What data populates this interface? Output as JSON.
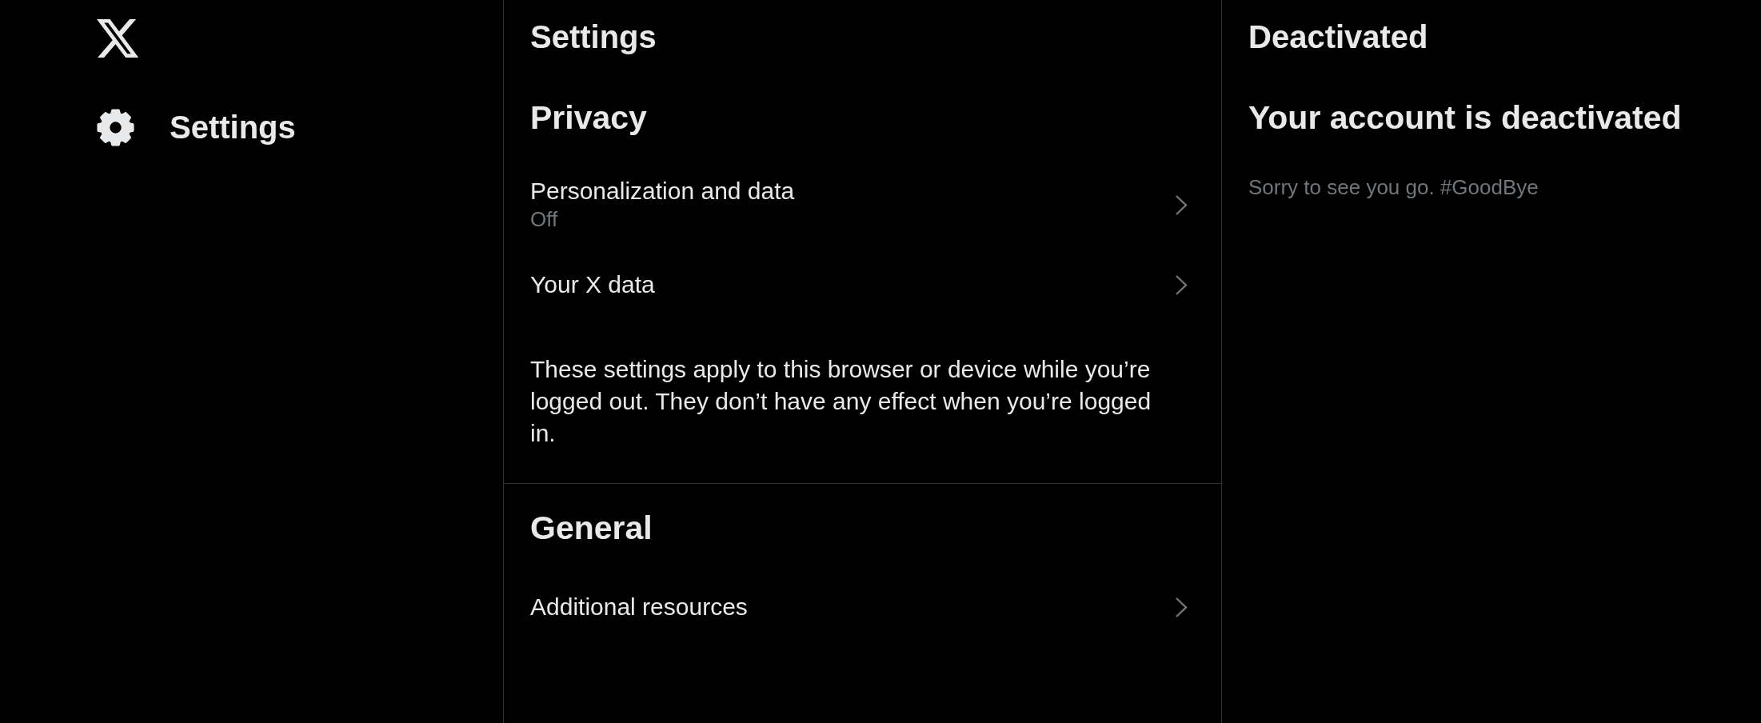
{
  "sidebar": {
    "items": [
      {
        "label": "Settings",
        "selected": true
      }
    ]
  },
  "settings_panel": {
    "title": "Settings",
    "sections": [
      {
        "title": "Privacy",
        "items": [
          {
            "label": "Personalization and data",
            "value": "Off"
          },
          {
            "label": "Your X data"
          }
        ],
        "note": "These settings apply to this browser or device while you’re logged out. They don’t have any effect when you’re logged in."
      },
      {
        "title": "General",
        "items": [
          {
            "label": "Additional resources"
          }
        ]
      }
    ]
  },
  "detail_panel": {
    "title": "Deactivated",
    "heading": "Your account is deactivated",
    "message": "Sorry to see you go. #GoodBye"
  }
}
